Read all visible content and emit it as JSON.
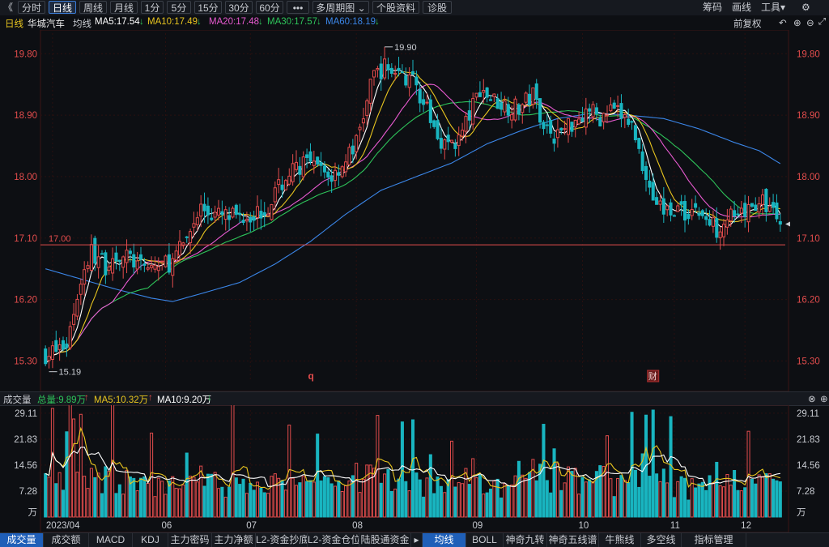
{
  "toolbar": {
    "back": "《",
    "buttons": [
      "分时",
      "日线",
      "周线",
      "月线",
      "1分",
      "5分",
      "15分",
      "30分",
      "60分",
      "•••",
      "多周期图 ⌄",
      "个股资料",
      "诊股"
    ],
    "active": 1,
    "right": [
      "筹码",
      "画线",
      "工具▾"
    ]
  },
  "info": {
    "period": "日线",
    "name": "华城汽车",
    "ma_label": "均线",
    "ma5": "MA5:17.54",
    "ma10": "MA10:17.49",
    "ma20": "MA20:17.48",
    "ma30": "MA30:17.57",
    "ma60": "MA60:18.19",
    "arrow_down": "↓",
    "adjust": "前复权"
  },
  "volinfo": {
    "title": "成交量",
    "total": "总量:9.89万",
    "ma5": "MA5:10.32万",
    "ma10": "MA10:9.20万",
    "arrow_up": "↑",
    "arrow_down": "↓"
  },
  "tabs": [
    "成交量",
    "成交额",
    "MACD",
    "KDJ",
    "主力密码",
    "主力净额",
    "L2-资金抄底",
    "L2-资金仓位",
    "陆股通资金",
    "▸",
    "均线",
    "BOLL",
    "神奇九转",
    "神奇五线谱",
    "牛熊线",
    "多空线",
    "指标管理"
  ],
  "colors": {
    "up": "#e24c4c",
    "down": "#19b5c0",
    "ma5": "#ffffff",
    "ma10": "#e8c51f",
    "ma20": "#e85ad0",
    "ma30": "#2ec45a",
    "ma60": "#3b86e8",
    "grid": "#2b0f0f"
  },
  "chart_data": {
    "type": "candlestick",
    "price_ticks": [
      "19.80",
      "18.90",
      "18.00",
      "17.10",
      "16.20",
      "15.30"
    ],
    "price_tick_values": [
      19.8,
      18.9,
      18.0,
      17.1,
      16.2,
      15.3
    ],
    "price_range": [
      15.02,
      20.1
    ],
    "vol_ticks": [
      "29.11",
      "21.83",
      "14.56",
      "7.28",
      "万"
    ],
    "vol_tick_values": [
      29.11,
      21.83,
      14.56,
      7.28
    ],
    "vol_range": [
      0,
      30
    ],
    "x_labels": [
      "2023/04",
      "06",
      "07",
      "08",
      "09",
      "10",
      "11",
      "12"
    ],
    "x_label_index": [
      2,
      34,
      58,
      88,
      122,
      152,
      178,
      198
    ],
    "support_line": 17.0,
    "support_label": "17.00",
    "high_label": "19.90",
    "low_label": "15.19",
    "high_index": 96,
    "low_index": 1,
    "markers": [
      {
        "index": 75,
        "text": "q"
      },
      {
        "index": 172,
        "text": "财"
      }
    ],
    "anchors": [
      [
        0,
        15.4
      ],
      [
        3,
        15.45
      ],
      [
        6,
        15.55
      ],
      [
        10,
        16.5
      ],
      [
        13,
        16.9
      ],
      [
        17,
        16.7
      ],
      [
        20,
        16.85
      ],
      [
        24,
        16.8
      ],
      [
        27,
        16.65
      ],
      [
        32,
        16.7
      ],
      [
        36,
        16.75
      ],
      [
        39,
        17.0
      ],
      [
        44,
        17.55
      ],
      [
        47,
        17.45
      ],
      [
        52,
        17.4
      ],
      [
        57,
        17.45
      ],
      [
        62,
        17.5
      ],
      [
        65,
        17.75
      ],
      [
        69,
        18.05
      ],
      [
        73,
        18.2
      ],
      [
        77,
        18.1
      ],
      [
        81,
        18.0
      ],
      [
        85,
        18.25
      ],
      [
        88,
        18.5
      ],
      [
        91,
        19.1
      ],
      [
        93,
        19.5
      ],
      [
        96,
        19.6
      ],
      [
        99,
        19.55
      ],
      [
        102,
        19.45
      ],
      [
        105,
        19.35
      ],
      [
        108,
        18.95
      ],
      [
        111,
        18.6
      ],
      [
        114,
        18.45
      ],
      [
        117,
        18.55
      ],
      [
        120,
        18.9
      ],
      [
        123,
        19.3
      ],
      [
        126,
        19.15
      ],
      [
        130,
        19.05
      ],
      [
        134,
        19.0
      ],
      [
        138,
        19.2
      ],
      [
        141,
        18.8
      ],
      [
        144,
        18.6
      ],
      [
        147,
        18.7
      ],
      [
        150,
        18.85
      ],
      [
        154,
        19.0
      ],
      [
        157,
        18.85
      ],
      [
        160,
        18.95
      ],
      [
        163,
        18.9
      ],
      [
        166,
        18.75
      ],
      [
        169,
        18.2
      ],
      [
        172,
        17.7
      ],
      [
        175,
        17.5
      ],
      [
        178,
        17.55
      ],
      [
        181,
        17.45
      ],
      [
        184,
        17.55
      ],
      [
        187,
        17.35
      ],
      [
        190,
        17.25
      ],
      [
        193,
        17.45
      ],
      [
        196,
        17.35
      ],
      [
        199,
        17.5
      ],
      [
        202,
        17.65
      ],
      [
        205,
        17.55
      ],
      [
        208,
        17.3
      ]
    ],
    "ma60_anchors": [
      [
        0,
        16.65
      ],
      [
        10,
        16.5
      ],
      [
        20,
        16.35
      ],
      [
        30,
        16.22
      ],
      [
        36,
        16.17
      ],
      [
        45,
        16.3
      ],
      [
        55,
        16.45
      ],
      [
        65,
        16.72
      ],
      [
        75,
        17.05
      ],
      [
        85,
        17.45
      ],
      [
        95,
        17.8
      ],
      [
        105,
        18.0
      ],
      [
        115,
        18.2
      ],
      [
        125,
        18.48
      ],
      [
        135,
        18.68
      ],
      [
        145,
        18.85
      ],
      [
        155,
        18.93
      ],
      [
        165,
        18.9
      ],
      [
        175,
        18.85
      ],
      [
        185,
        18.7
      ],
      [
        195,
        18.5
      ],
      [
        202,
        18.38
      ],
      [
        208,
        18.19
      ]
    ],
    "count": 209
  }
}
